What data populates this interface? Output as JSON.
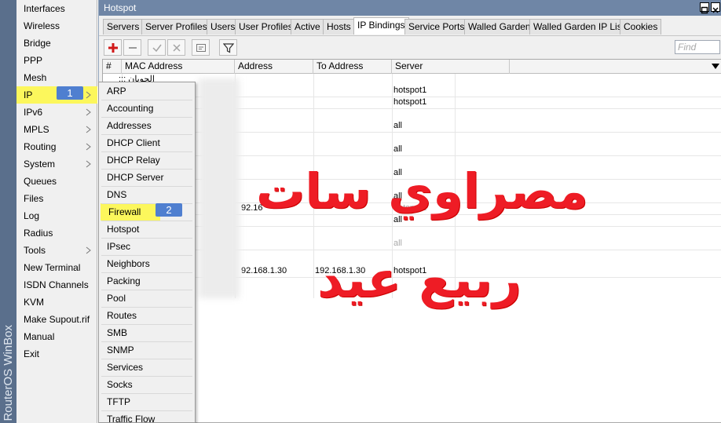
{
  "brand": {
    "text": "RouterOS WinBox"
  },
  "main_menu": {
    "items": [
      {
        "label": "Interfaces",
        "submenu": false
      },
      {
        "label": "Wireless",
        "submenu": false
      },
      {
        "label": "Bridge",
        "submenu": false
      },
      {
        "label": "PPP",
        "submenu": false
      },
      {
        "label": "Mesh",
        "submenu": false
      },
      {
        "label": "IP",
        "submenu": true,
        "selected": true
      },
      {
        "label": "IPv6",
        "submenu": true
      },
      {
        "label": "MPLS",
        "submenu": true
      },
      {
        "label": "Routing",
        "submenu": true
      },
      {
        "label": "System",
        "submenu": true
      },
      {
        "label": "Queues",
        "submenu": false
      },
      {
        "label": "Files",
        "submenu": false
      },
      {
        "label": "Log",
        "submenu": false
      },
      {
        "label": "Radius",
        "submenu": false
      },
      {
        "label": "Tools",
        "submenu": true
      },
      {
        "label": "New Terminal",
        "submenu": false
      },
      {
        "label": "ISDN Channels",
        "submenu": false
      },
      {
        "label": "KVM",
        "submenu": false
      },
      {
        "label": "Make Supout.rif",
        "submenu": false
      },
      {
        "label": "Manual",
        "submenu": false
      },
      {
        "label": "Exit",
        "submenu": false
      }
    ]
  },
  "window": {
    "title": "Hotspot",
    "tabs": [
      "Servers",
      "Server Profiles",
      "Users",
      "User Profiles",
      "Active",
      "Hosts",
      "IP Bindings",
      "Service Ports",
      "Walled Garden",
      "Walled Garden IP List",
      "Cookies"
    ],
    "active_tab": "IP Bindings",
    "toolbar": {
      "add_icon": "plus-icon",
      "remove_icon": "minus-icon",
      "enable_icon": "check-icon",
      "disable_icon": "cross-icon",
      "comment_icon": "comment-icon",
      "filter_icon": "filter-icon"
    },
    "find_placeholder": "Find"
  },
  "table": {
    "columns": [
      "#",
      "MAC Address",
      "Address",
      "To Address",
      "Server"
    ],
    "comment_row": ";;; الجوبان",
    "rows": [
      {
        "address": "",
        "to_address": "",
        "server": "hotspot1"
      },
      {
        "address": "",
        "to_address": "",
        "server": "hotspot1"
      },
      {
        "address": "",
        "to_address": "",
        "server": "all"
      },
      {
        "address": "",
        "to_address": "",
        "server": "all"
      },
      {
        "address": "",
        "to_address": "",
        "server": "all"
      },
      {
        "address": "",
        "to_address": "",
        "server": "all"
      },
      {
        "address": "92.16",
        "to_address": "",
        "server": "hotspot1"
      },
      {
        "address": "",
        "to_address": "",
        "server": "all"
      },
      {
        "address": "",
        "to_address": "",
        "server": "all"
      },
      {
        "address": "92.168.1.30",
        "to_address": "192.168.1.30",
        "server": "hotspot1"
      }
    ]
  },
  "ip_submenu": {
    "items": [
      "ARP",
      "Accounting",
      "Addresses",
      "DHCP Client",
      "DHCP Relay",
      "DHCP Server",
      "DNS",
      "Firewall",
      "Hotspot",
      "IPsec",
      "Neighbors",
      "Packing",
      "Pool",
      "Routes",
      "SMB",
      "SNMP",
      "Services",
      "Socks",
      "TFTP",
      "Traffic Flow"
    ],
    "selected": "Firewall"
  },
  "badges": {
    "step1": "1",
    "step2": "2"
  },
  "overlay": {
    "line1": "مصراوي سات",
    "line2": "ربيع عيد",
    "color": "#ee1c25"
  }
}
